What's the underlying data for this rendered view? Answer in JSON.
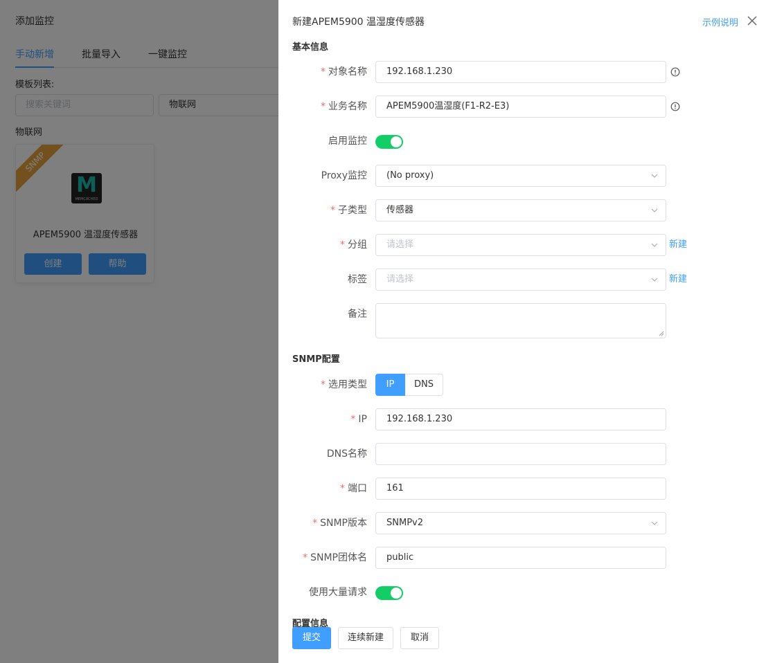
{
  "background": {
    "title": "添加监控",
    "tabs": [
      {
        "label": "手动新增",
        "active": true
      },
      {
        "label": "批量导入",
        "active": false
      },
      {
        "label": "一键监控",
        "active": false
      }
    ],
    "template_list_label": "模板列表:",
    "search_placeholder": "搜索关键词",
    "category_select": "物联网",
    "category_heading": "物联网",
    "card": {
      "ribbon": "SNMP",
      "logo_letter": "M",
      "logo_text": "MEMCACHED",
      "title": "APEM5900 温湿度传感器",
      "create_label": "创建",
      "help_label": "帮助"
    }
  },
  "drawer": {
    "title": "新建APEM5900 温湿度传感器",
    "example_link": "示例说明",
    "basic_section": "基本信息",
    "fields": {
      "object_name": {
        "label": "对象名称",
        "required": true,
        "value": "192.168.1.230"
      },
      "business_name": {
        "label": "业务名称",
        "required": true,
        "value": "APEM5900温湿度(F1-R2-E3)"
      },
      "enable_monitor": {
        "label": "启用监控",
        "on": true
      },
      "proxy": {
        "label": "Proxy监控",
        "value": "(No proxy)"
      },
      "subtype": {
        "label": "子类型",
        "required": true,
        "value": "传感器"
      },
      "group": {
        "label": "分组",
        "required": true,
        "placeholder": "请选择",
        "new_link": "新建"
      },
      "tags": {
        "label": "标签",
        "placeholder": "请选择",
        "new_link": "新建"
      },
      "remark": {
        "label": "备注",
        "value": ""
      }
    },
    "snmp_section": "SNMP配置",
    "snmp": {
      "select_type": {
        "label": "选用类型",
        "required": true,
        "options": [
          "IP",
          "DNS"
        ],
        "selected": "IP"
      },
      "ip": {
        "label": "IP",
        "required": true,
        "value": "192.168.1.230"
      },
      "dns_name": {
        "label": "DNS名称",
        "value": ""
      },
      "port": {
        "label": "端口",
        "required": true,
        "value": "161"
      },
      "version": {
        "label": "SNMP版本",
        "required": true,
        "value": "SNMPv2"
      },
      "community": {
        "label": "SNMP团体名",
        "required": true,
        "value": "public"
      },
      "bulk": {
        "label": "使用大量请求",
        "on": true
      }
    },
    "config_section": "配置信息",
    "buttons": {
      "submit": "提交",
      "continue_new": "连续新建",
      "cancel": "取消"
    }
  },
  "colors": {
    "primary": "#409eff",
    "switch_on": "#13ce66",
    "required": "#f56c6c",
    "ribbon": "#e6a23c"
  }
}
